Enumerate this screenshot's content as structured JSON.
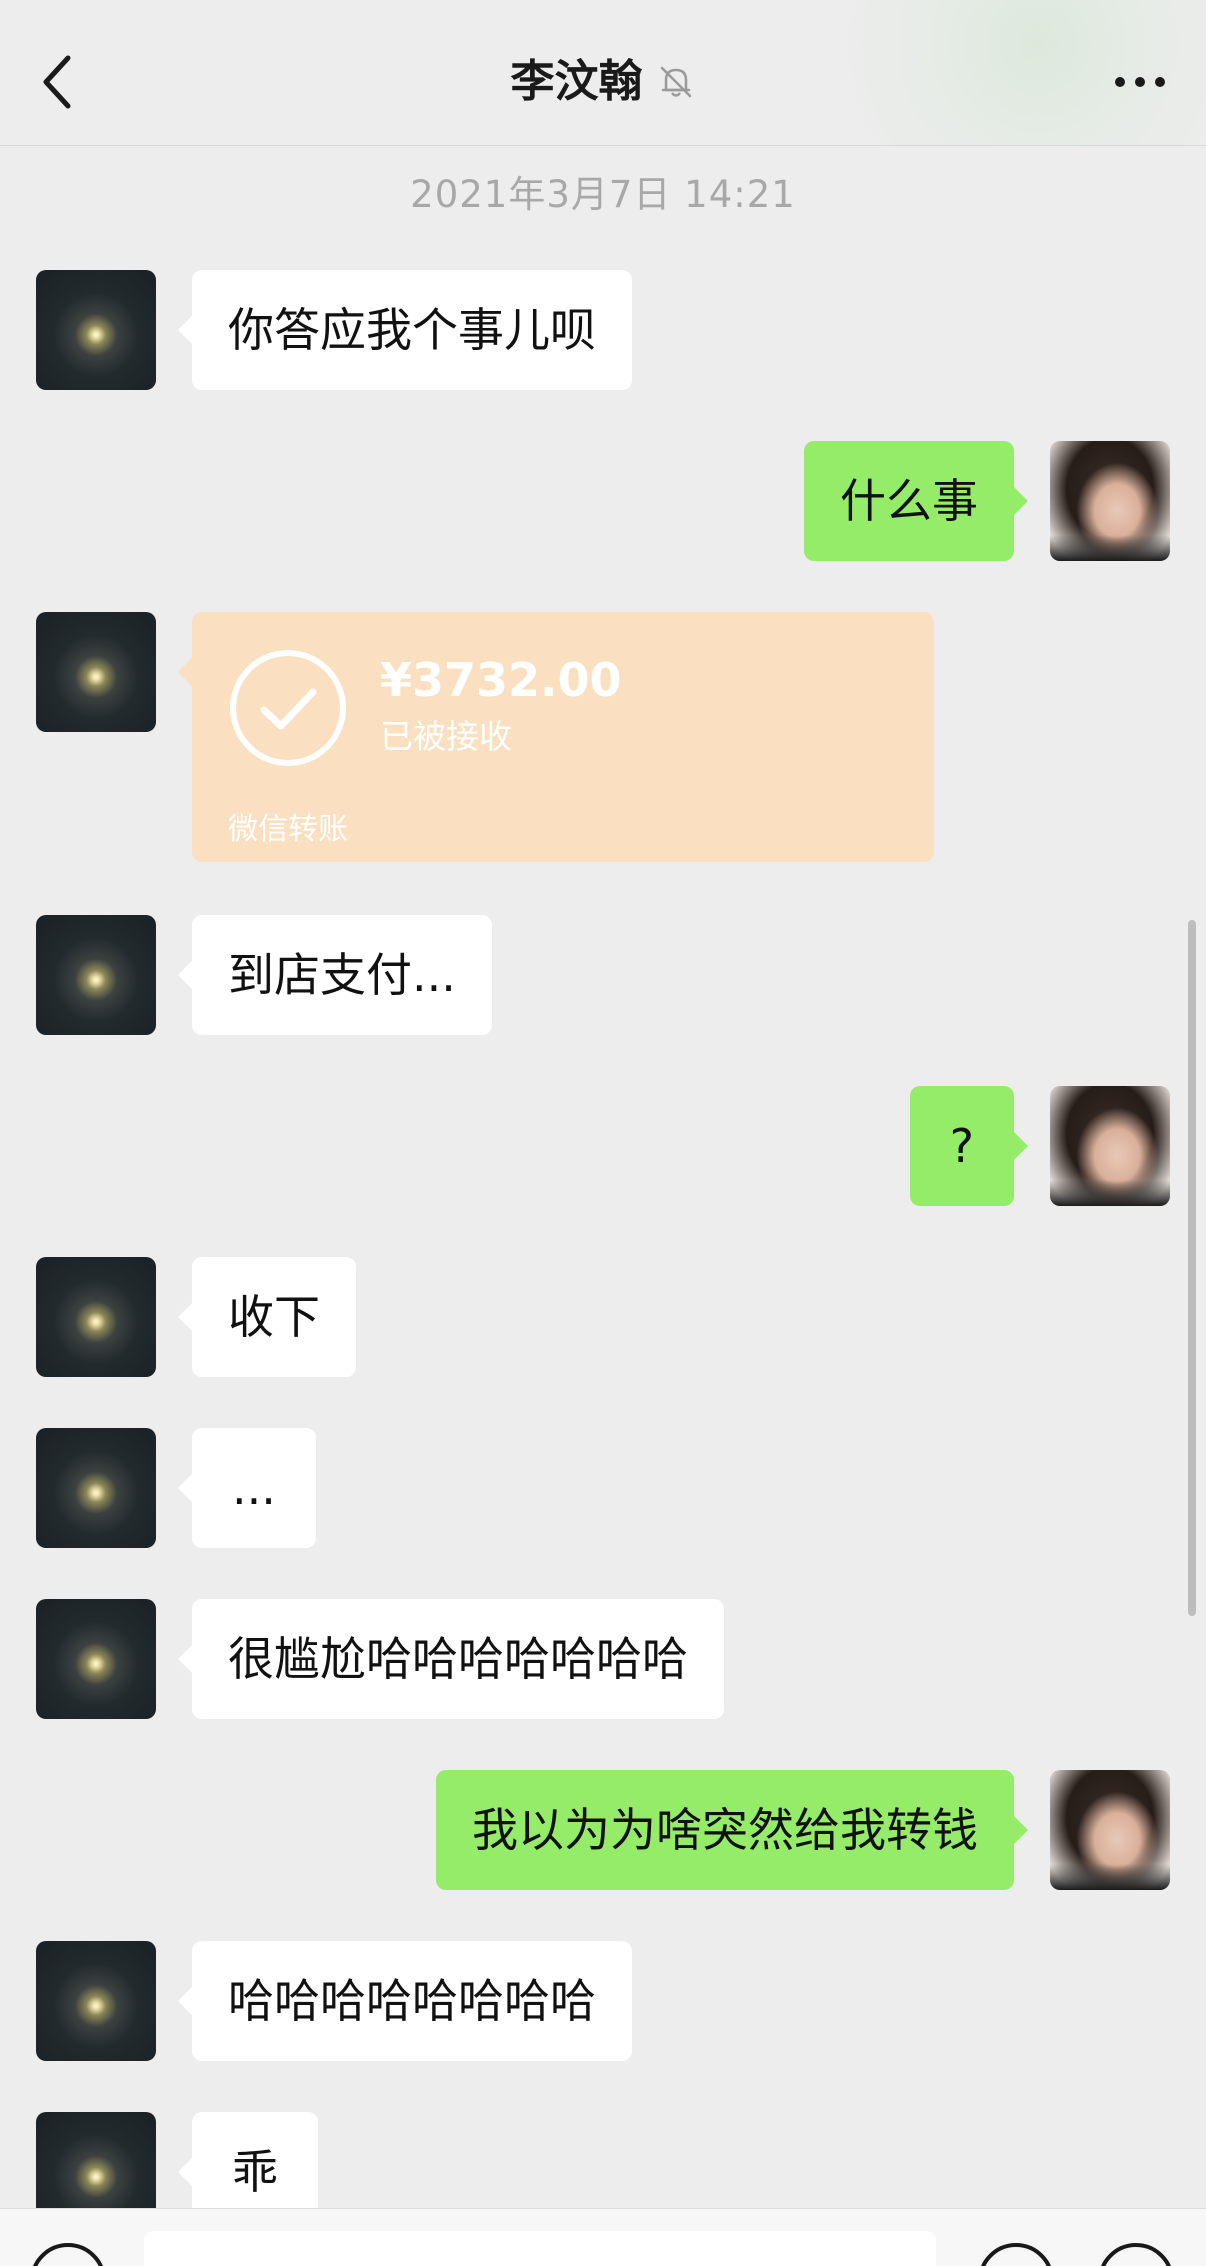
{
  "header": {
    "title": "李汶翰",
    "back_icon": "chevron-left-icon",
    "mute_icon": "bell-muted-icon",
    "more_icon": "ellipsis-icon"
  },
  "timestamp": "2021年3月7日 14:21",
  "messages": [
    {
      "sender": "other",
      "type": "text",
      "text": "你答应我个事儿呗"
    },
    {
      "sender": "me",
      "type": "text",
      "text": "什么事"
    },
    {
      "sender": "other",
      "type": "transfer",
      "amount": "¥3732.00",
      "status": "已被接收",
      "label": "微信转账"
    },
    {
      "sender": "other",
      "type": "text",
      "text": "到店支付..."
    },
    {
      "sender": "me",
      "type": "text",
      "text": "?"
    },
    {
      "sender": "other",
      "type": "text",
      "text": "收下"
    },
    {
      "sender": "other",
      "type": "text",
      "text": "..."
    },
    {
      "sender": "other",
      "type": "text",
      "text": "很尴尬哈哈哈哈哈哈哈"
    },
    {
      "sender": "me",
      "type": "text",
      "text": "我以为为啥突然给我转钱"
    },
    {
      "sender": "other",
      "type": "text",
      "text": "哈哈哈哈哈哈哈哈"
    },
    {
      "sender": "other",
      "type": "text",
      "text": "乖"
    }
  ],
  "colors": {
    "background": "#ededed",
    "bubble_self": "#95ec69",
    "bubble_other": "#ffffff",
    "transfer_card": "#fae0c1"
  },
  "input_bar": {
    "voice_icon": "voice-icon",
    "emoji_icon": "emoji-icon",
    "plus_icon": "plus-icon"
  }
}
